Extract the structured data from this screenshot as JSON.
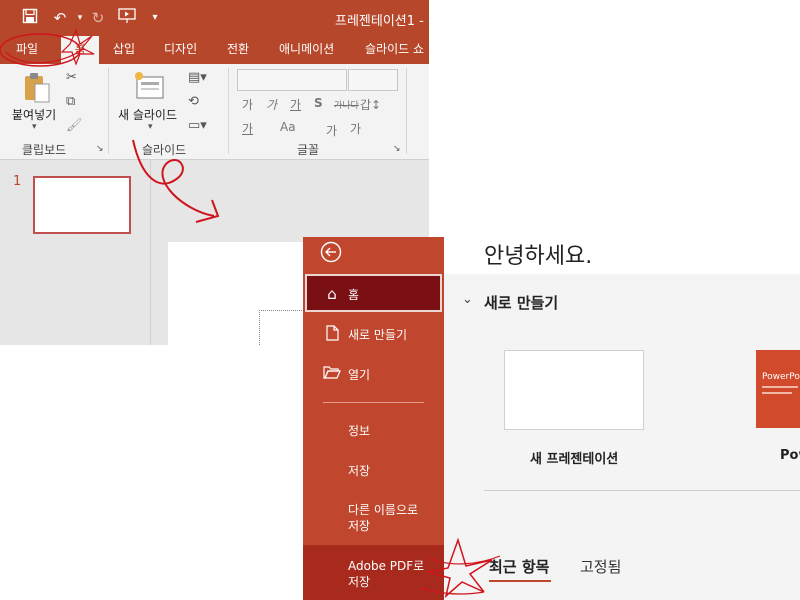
{
  "window": {
    "title": "프레젠테이션1 -"
  },
  "quick_access": {
    "icons": [
      "save-icon",
      "undo-icon",
      "redo-icon",
      "present-icon",
      "customize-icon"
    ]
  },
  "ribbon": {
    "tabs": [
      "파일",
      "홈",
      "삽입",
      "디자인",
      "전환",
      "애니메이션",
      "슬라이드 쇼"
    ],
    "active_tab": "홈",
    "groups": {
      "clipboard": {
        "label": "클립보드",
        "paste_label": "붙여넣기"
      },
      "slides": {
        "label": "슬라이드",
        "new_slide_label": "새 슬라이드"
      },
      "font": {
        "label": "글꼴",
        "row1": [
          "가",
          "가",
          "가",
          "S",
          "가나다",
          "갑↕"
        ],
        "row2": [
          "가",
          "Aa",
          "가",
          "가"
        ]
      }
    }
  },
  "thumbnail_pane": {
    "slide_number": "1"
  },
  "backstage": {
    "nav": [
      {
        "label": "홈",
        "icon": "home-icon",
        "selected": true
      },
      {
        "label": "새로 만들기",
        "icon": "new-document-icon"
      },
      {
        "label": "열기",
        "icon": "open-folder-icon"
      },
      {
        "label": "정보"
      },
      {
        "label": "저장"
      },
      {
        "label": "다른 이름으로\n저장"
      },
      {
        "label": "Adobe PDF로\n저장"
      }
    ],
    "back_icon": "back-arrow-icon",
    "greeting": "안녕하세요.",
    "new_section": {
      "title": "새로 만들기",
      "templates": [
        {
          "name": "새 프레젠테이션"
        },
        {
          "name": "Pow",
          "thumb_text": "PowerPoint"
        }
      ]
    },
    "tabs": [
      {
        "label": "최근 항목",
        "active": true
      },
      {
        "label": "고정됨",
        "active": false
      }
    ]
  },
  "colors": {
    "accent": "#b7472a",
    "backstage_nav": "#c0462d",
    "nav_selected": "#7a0f14",
    "annotation": "#d0141c"
  }
}
